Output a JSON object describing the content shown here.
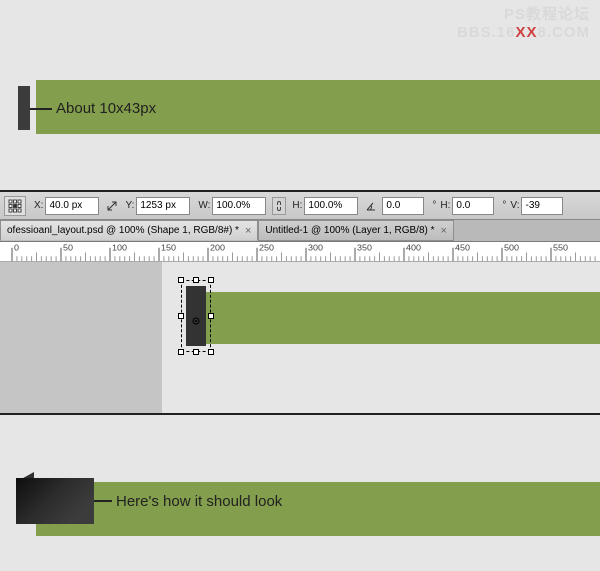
{
  "watermark": {
    "line1": "PS教程论坛",
    "line2_a": "BBS.16",
    "line2_xx": "XX",
    "line2_b": "8.COM"
  },
  "section1": {
    "annotation": "About 10x43px"
  },
  "photoshop": {
    "options": {
      "x_label": "X:",
      "x_value": "40.0 px",
      "y_label": "Y:",
      "y_value": "1253 px",
      "w_label": "W:",
      "w_value": "100.0%",
      "h_label": "H:",
      "h_value": "100.0%",
      "angle_label": "",
      "angle_value": "0.0",
      "skew_h_label": "H:",
      "skew_h_value": "0.0",
      "skew_v_label": "V:",
      "skew_v_value": "-39"
    },
    "tabs": {
      "tab1": "ofessioanl_layout.psd @ 100% (Shape 1, RGB/8#) *",
      "tab2": "Untitled-1 @ 100% (Layer 1, RGB/8) *"
    },
    "ruler_ticks": [
      "0",
      "50",
      "100",
      "150",
      "200",
      "250",
      "300",
      "350",
      "400",
      "450",
      "500",
      "550"
    ]
  },
  "section3": {
    "annotation": "Here's how it should look"
  }
}
